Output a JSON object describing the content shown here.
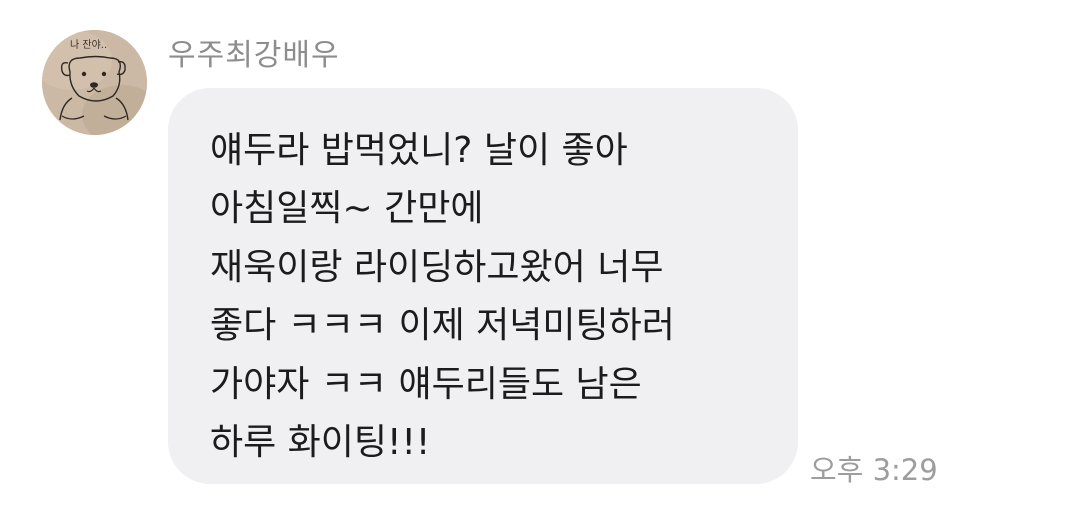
{
  "message": {
    "sender_name": "우주최강배우",
    "avatar_icon": "bear-drawing-avatar",
    "avatar_text": "나 잔야..",
    "lines": [
      "얘두라 밥먹었니? 날이 좋아",
      "아침일찍~ 간만에",
      "재욱이랑 라이딩하고왔어 너무",
      "좋다 ㅋㅋㅋ 이제 저녁미팅하러",
      "가야자 ㅋㅋ 얘두리들도 남은",
      "하루 화이팅!!!"
    ],
    "timestamp": "오후 3:29"
  },
  "colors": {
    "bubble": "#f0f0f3",
    "sender": "#8d8d8d",
    "timestamp": "#9d9d9d",
    "text": "#1c1c1c"
  }
}
